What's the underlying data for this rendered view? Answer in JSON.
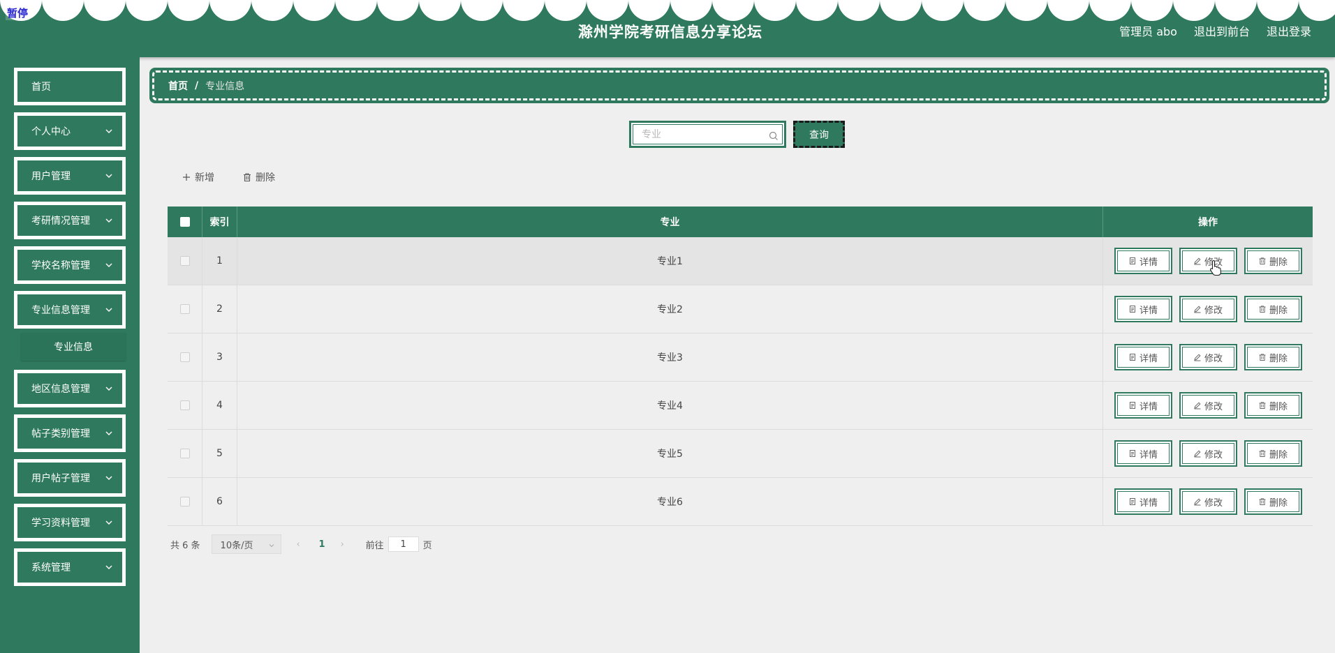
{
  "header": {
    "title": "滁州学院考研信息分享论坛",
    "pause_tag": "暂停",
    "user_label": "管理员 abo",
    "front_link": "退出到前台",
    "logout_link": "退出登录"
  },
  "sidebar": {
    "items": [
      {
        "label": "首页"
      },
      {
        "label": "个人中心"
      },
      {
        "label": "用户管理"
      },
      {
        "label": "考研情况管理"
      },
      {
        "label": "学校名称管理"
      },
      {
        "label": "专业信息管理"
      },
      {
        "label": "地区信息管理"
      },
      {
        "label": "帖子类别管理"
      },
      {
        "label": "用户帖子管理"
      },
      {
        "label": "学习资料管理"
      },
      {
        "label": "系统管理"
      }
    ],
    "submenu": {
      "label": "专业信息"
    }
  },
  "breadcrumb": {
    "home": "首页",
    "separator": "/",
    "current": "专业信息"
  },
  "search": {
    "placeholder": "专业",
    "value": "",
    "button": "查询"
  },
  "actions": {
    "add": "新增",
    "delete": "删除"
  },
  "table": {
    "columns": {
      "index": "索引",
      "major": "专业",
      "ops": "操作"
    },
    "op_labels": {
      "detail": "详情",
      "edit": "修改",
      "delete": "删除"
    },
    "rows": [
      {
        "index": "1",
        "major": "专业1"
      },
      {
        "index": "2",
        "major": "专业2"
      },
      {
        "index": "3",
        "major": "专业3"
      },
      {
        "index": "4",
        "major": "专业4"
      },
      {
        "index": "5",
        "major": "专业5"
      },
      {
        "index": "6",
        "major": "专业6"
      }
    ]
  },
  "pagination": {
    "total": "共 6 条",
    "page_size": "10条/页",
    "current_page": "1",
    "goto_label": "前往",
    "goto_value": "1",
    "goto_suffix": "页"
  },
  "colors": {
    "primary": "#2f7a5e",
    "background": "#efefef",
    "white": "#ffffff"
  }
}
